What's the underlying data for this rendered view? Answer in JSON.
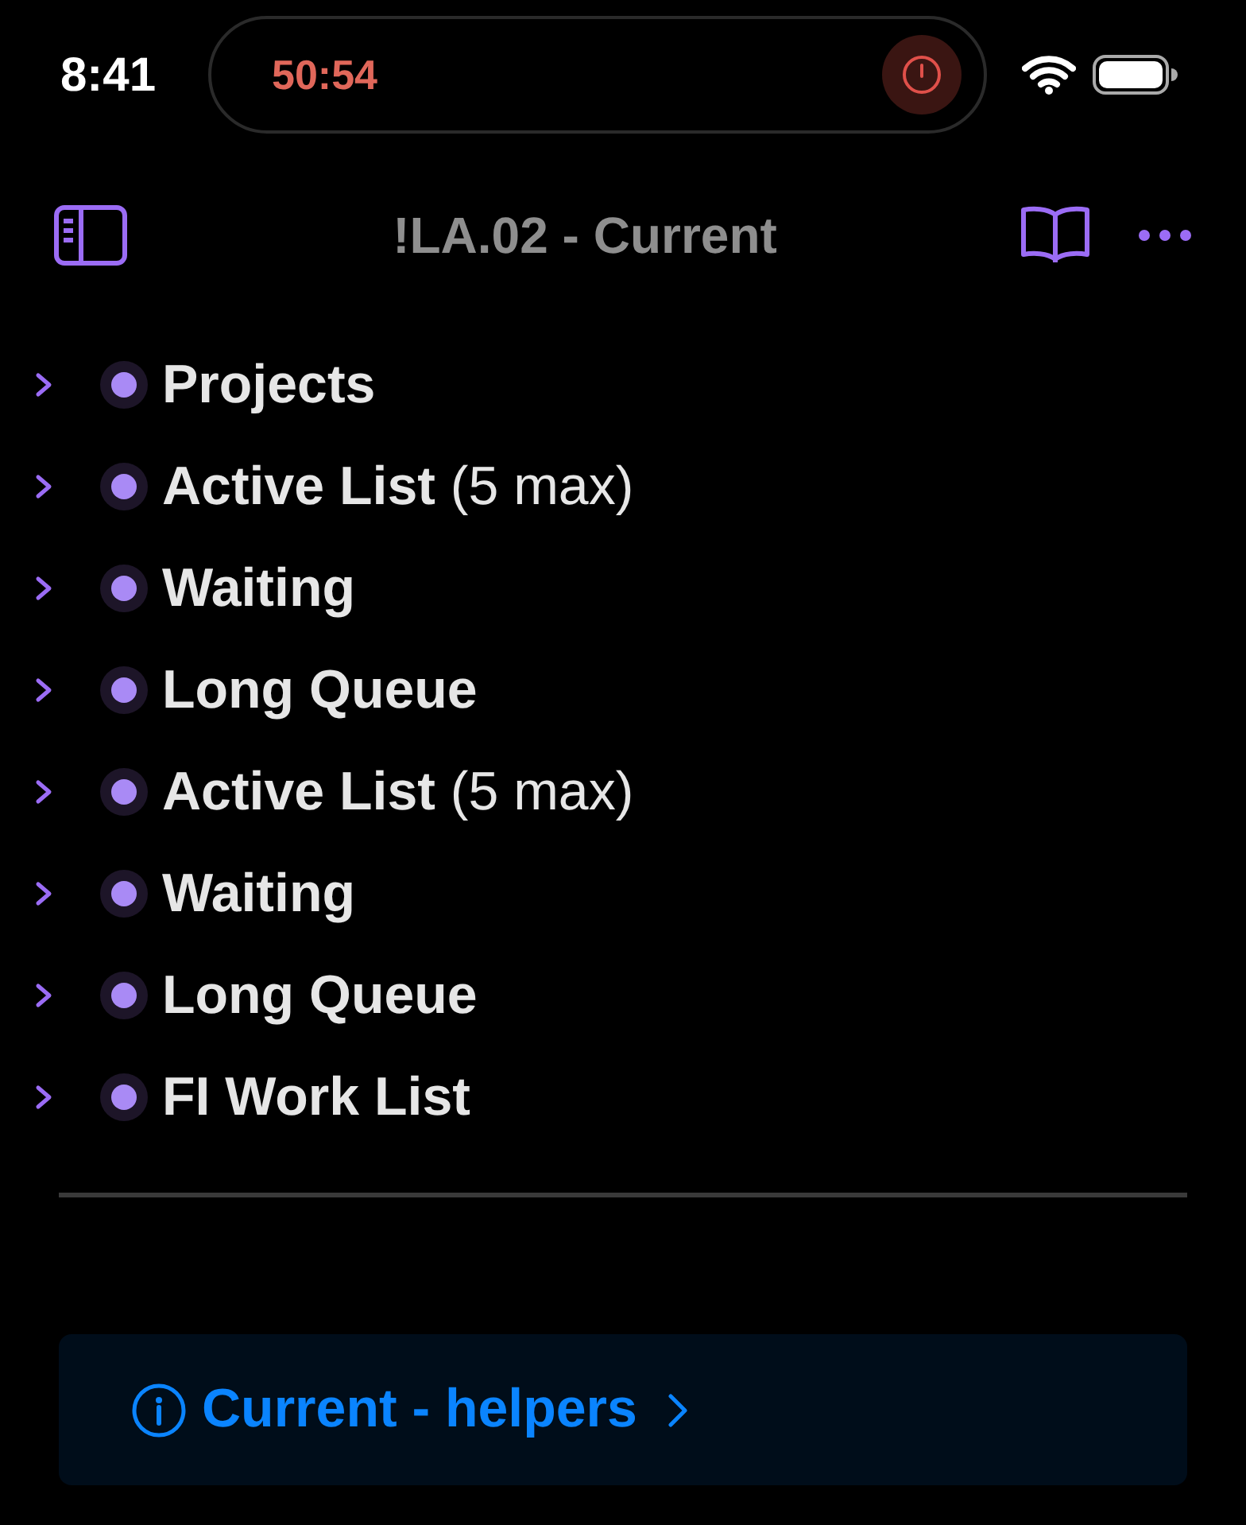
{
  "status_bar": {
    "time": "8:41",
    "timer": "50:54"
  },
  "nav": {
    "title": "!LA.02 - Current"
  },
  "items": [
    {
      "label": "Projects",
      "expanded": false
    },
    {
      "label": "Active List",
      "note": "(5 max)",
      "expanded": false
    },
    {
      "label": "Waiting",
      "expanded": false
    },
    {
      "label": "Long Queue",
      "expanded": false
    },
    {
      "label": "Active List",
      "note": "(5 max)",
      "expanded": false
    },
    {
      "label": "Waiting",
      "expanded": false
    },
    {
      "label": "Long Queue",
      "expanded": false
    },
    {
      "label": "FI Work List",
      "expanded": false
    }
  ],
  "helper_link": {
    "label": "Current - helpers"
  }
}
